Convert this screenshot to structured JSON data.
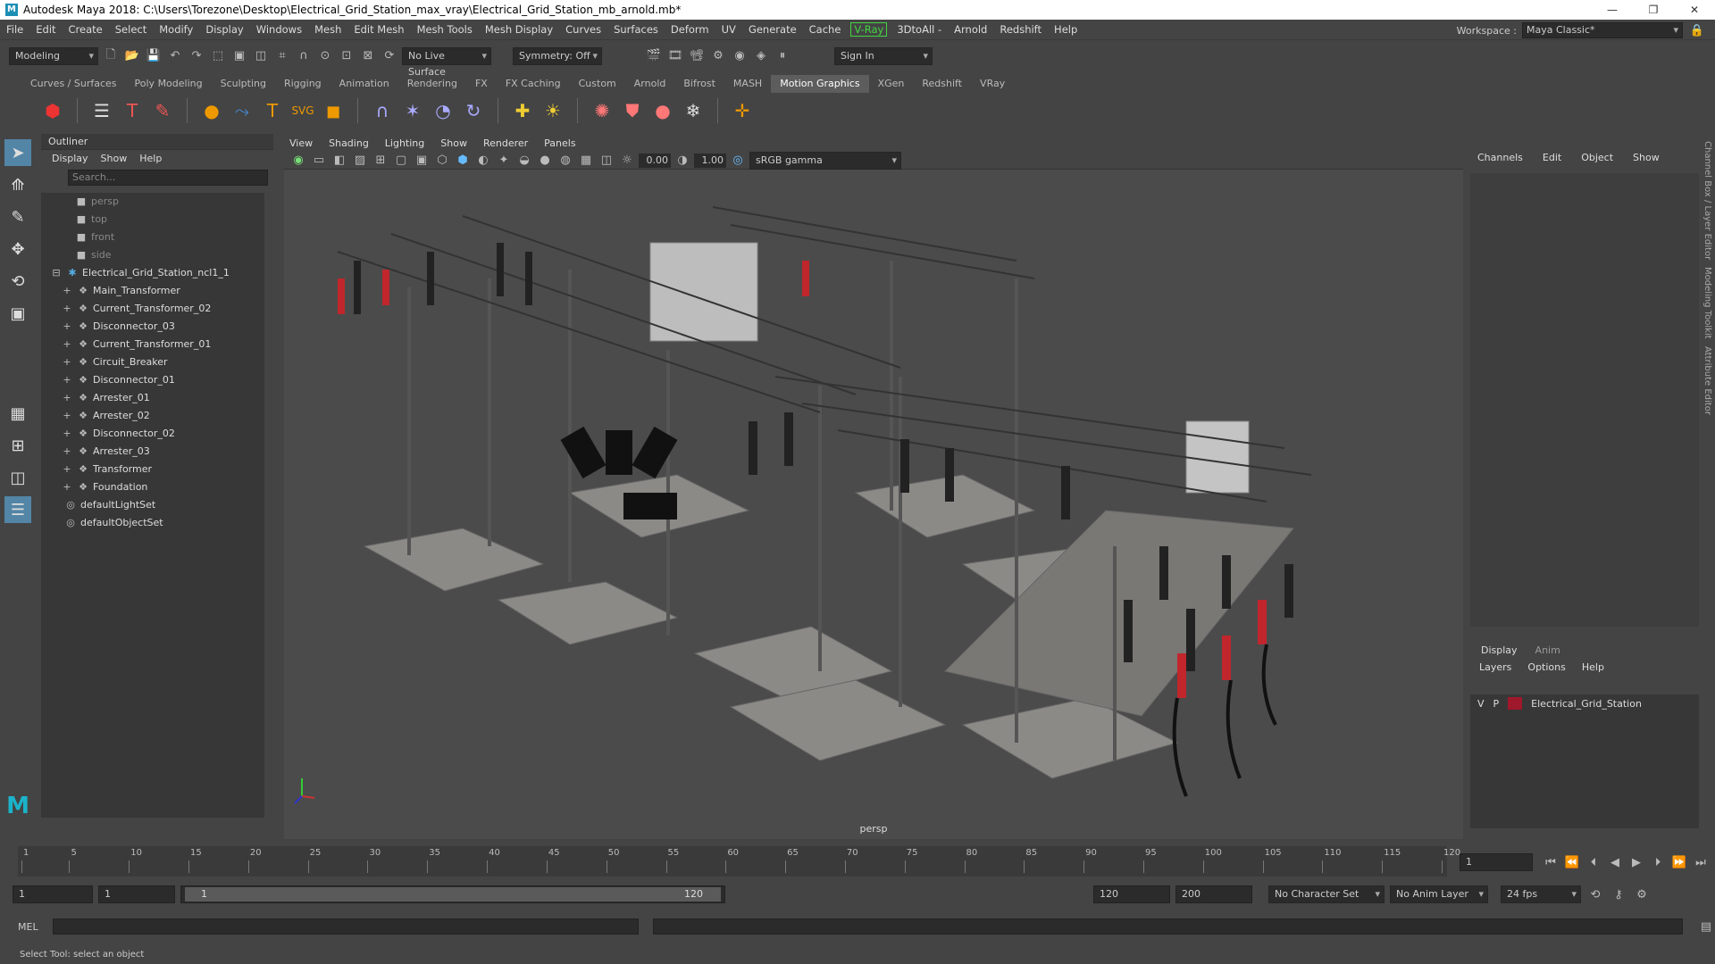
{
  "window": {
    "title": "Autodesk Maya 2018: C:\\Users\\Torezone\\Desktop\\Electrical_Grid_Station_max_vray\\Electrical_Grid_Station_mb_arnold.mb*",
    "logo": "M"
  },
  "menubar": {
    "items": [
      "File",
      "Edit",
      "Create",
      "Select",
      "Modify",
      "Display",
      "Windows",
      "Mesh",
      "Edit Mesh",
      "Mesh Tools",
      "Mesh Display",
      "Curves",
      "Surfaces",
      "Deform",
      "UV",
      "Generate",
      "Cache"
    ],
    "vray": "V-Ray",
    "items_after": [
      "3DtoAll -",
      "Arnold",
      "Redshift",
      "Help"
    ],
    "workspace_label": "Workspace :",
    "workspace_value": "Maya Classic*"
  },
  "statusline": {
    "mode": "Modeling",
    "live_surface": "No Live Surface",
    "symmetry": "Symmetry: Off",
    "sign_in": "Sign In"
  },
  "shelf_tabs": [
    "Curves / Surfaces",
    "Poly Modeling",
    "Sculpting",
    "Rigging",
    "Animation",
    "Rendering",
    "FX",
    "FX Caching",
    "Custom",
    "Arnold",
    "Bifrost",
    "MASH",
    "Motion Graphics",
    "XGen",
    "Redshift",
    "VRay"
  ],
  "shelf_active": "Motion Graphics",
  "outliner": {
    "title": "Outliner",
    "menus": [
      "Display",
      "Show",
      "Help"
    ],
    "search_placeholder": "Search...",
    "cameras": [
      "persp",
      "top",
      "front",
      "side"
    ],
    "root": "Electrical_Grid_Station_ncl1_1",
    "children": [
      "Main_Transformer",
      "Current_Transformer_02",
      "Disconnector_03",
      "Current_Transformer_01",
      "Circuit_Breaker",
      "Disconnector_01",
      "Arrester_01",
      "Arrester_02",
      "Disconnector_02",
      "Arrester_03",
      "Transformer",
      "Foundation"
    ],
    "sets": [
      "defaultLightSet",
      "defaultObjectSet"
    ]
  },
  "viewport": {
    "menus": [
      "View",
      "Shading",
      "Lighting",
      "Show",
      "Renderer",
      "Panels"
    ],
    "exposure": "0.00",
    "gamma": "1.00",
    "colorspace": "sRGB gamma",
    "camera_label": "persp"
  },
  "channelbox": {
    "menus": [
      "Channels",
      "Edit",
      "Object",
      "Show"
    ]
  },
  "layers": {
    "tabs": [
      "Display",
      "Anim"
    ],
    "menus": [
      "Layers",
      "Options",
      "Help"
    ],
    "layer": {
      "v": "V",
      "p": "P",
      "name": "Electrical_Grid_Station",
      "color": "#a0182b"
    }
  },
  "sidetabs": [
    "Channel Box / Layer Editor",
    "Modeling Toolkit",
    "Attribute Editor"
  ],
  "timeline": {
    "ticks": [
      "1",
      "5",
      "10",
      "15",
      "20",
      "25",
      "30",
      "35",
      "40",
      "45",
      "50",
      "55",
      "60",
      "65",
      "70",
      "75",
      "80",
      "85",
      "90",
      "95",
      "100",
      "105",
      "110",
      "115",
      "120"
    ],
    "current_frame": "1"
  },
  "range": {
    "start": "1",
    "start2": "1",
    "range_start": "1",
    "range_end": "120",
    "end": "120",
    "end2": "200",
    "character_set": "No Character Set",
    "anim_layer": "No Anim Layer",
    "fps": "24 fps"
  },
  "mel": {
    "label": "MEL"
  },
  "help": {
    "text": "Select Tool: select an object"
  }
}
